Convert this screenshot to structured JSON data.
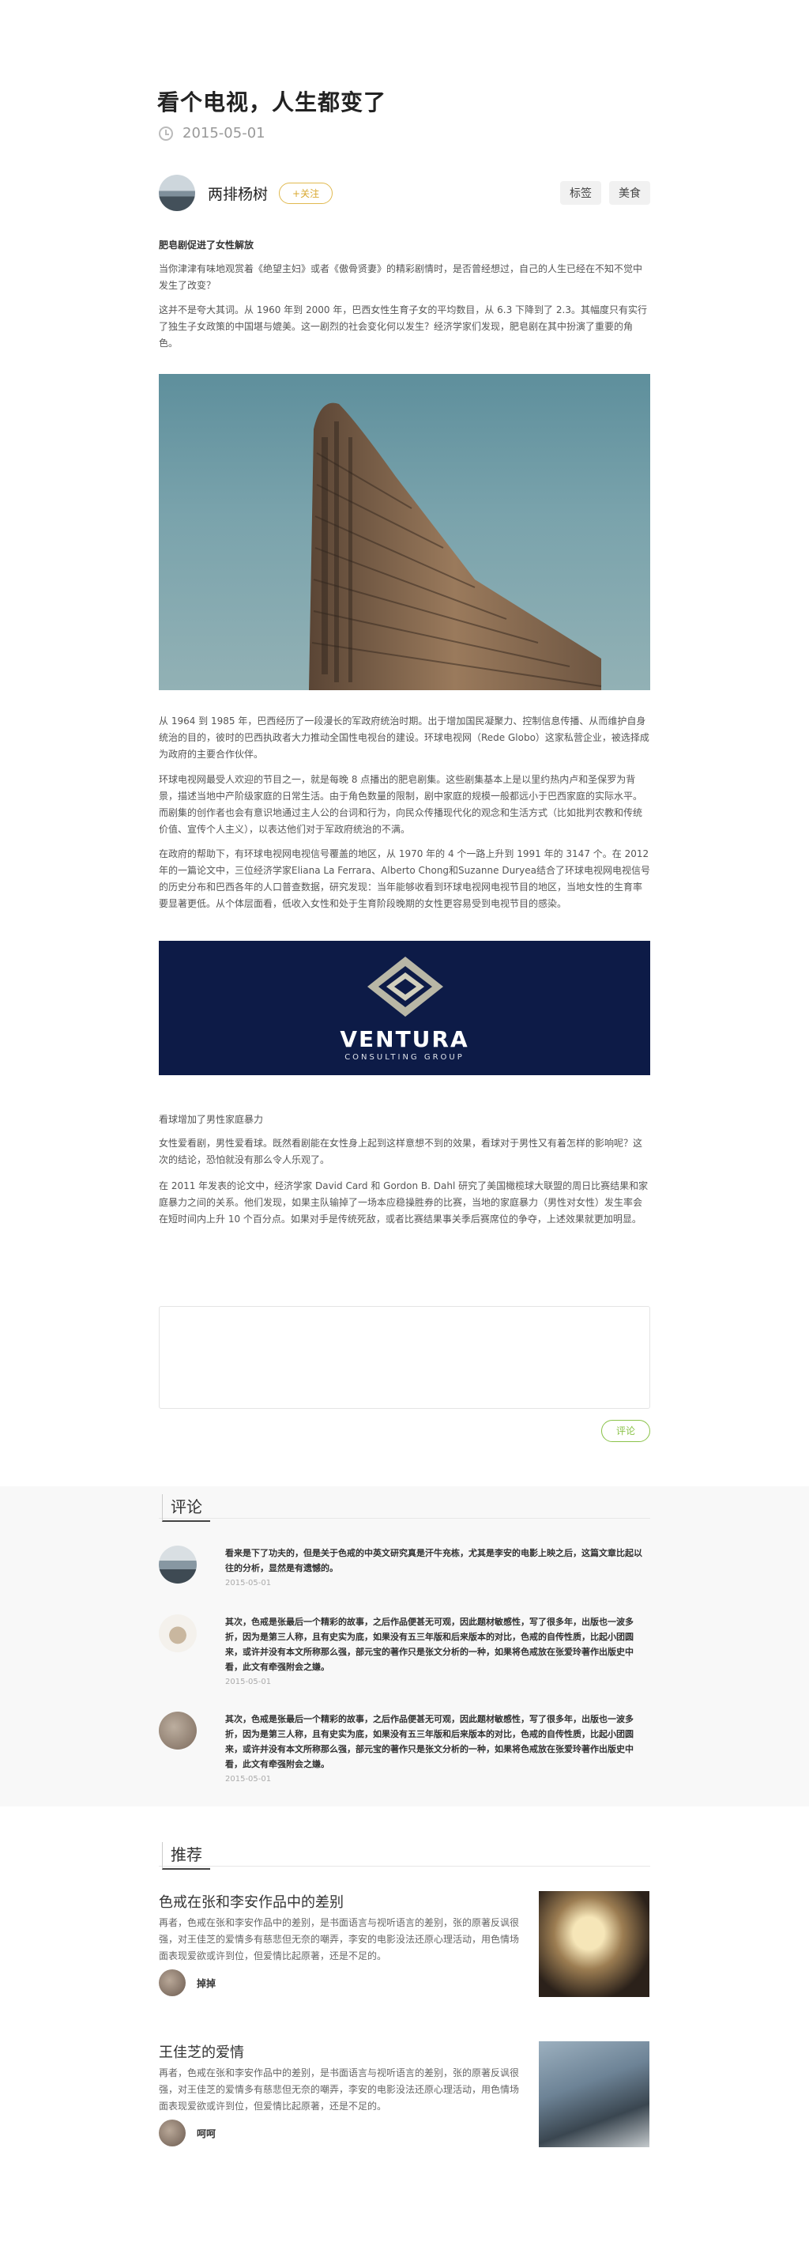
{
  "article": {
    "title": "看个电视，人生都变了",
    "date": "2015-05-01",
    "author": "两排杨树",
    "follow_label": "+关注",
    "tags": [
      "标签",
      "美食"
    ]
  },
  "content": {
    "heading1": "肥皂剧促进了女性解放",
    "para1": "当你津津有味地观赏着《绝望主妇》或者《傲骨贤妻》的精彩剧情时，是否曾经想过，自己的人生已经在不知不觉中发生了改变？",
    "para2": "这并不是夸大其词。从 1960 年到 2000 年，巴西女性生育子女的平均数目，从 6.3 下降到了 2.3。其幅度只有实行了独生子女政策的中国堪与媲美。这一剧烈的社会变化何以发生？经济学家们发现，肥皂剧在其中扮演了重要的角色。",
    "para3": "从 1964 到 1985 年，巴西经历了一段漫长的军政府统治时期。出于增加国民凝聚力、控制信息传播、从而维护自身统治的目的，彼时的巴西执政者大力推动全国性电视台的建设。环球电视网（Rede Globo）这家私营企业，被选择成为政府的主要合作伙伴。",
    "para4": "环球电视网最受人欢迎的节目之一，就是每晚 8 点播出的肥皂剧集。这些剧集基本上是以里约热内卢和圣保罗为背景，描述当地中产阶级家庭的日常生活。由于角色数量的限制，剧中家庭的规模一般都远小于巴西家庭的实际水平。而剧集的创作者也会有意识地通过主人公的台词和行为，向民众传播现代化的观念和生活方式（比如批判农教和传统价值、宣传个人主义），以表达他们对于军政府统治的不满。",
    "para5": "在政府的帮助下，有环球电视网电视信号覆盖的地区，从 1970 年的 4 个一路上升到 1991 年的 3147 个。在 2012 年的一篇论文中，三位经济学家Eliana La Ferrara、Alberto Chong和Suzanne Duryea结合了环球电视网电视信号的历史分布和巴西各年的人口普查数据，研究发现：当年能够收看到环球电视网电视节目的地区，当地女性的生育率要显著更低。从个体层面看，低收入女性和处于生育阶段晚期的女性更容易受到电视节目的感染。",
    "heading2": "看球增加了男性家庭暴力",
    "para6": "女性爱看剧，男性爱看球。既然看剧能在女性身上起到这样意想不到的效果，看球对于男性又有着怎样的影响呢？这次的结论，恐怕就没有那么令人乐观了。",
    "para7": "在 2011 年发表的论文中，经济学家 David Card 和 Gordon B. Dahl 研究了美国橄榄球大联盟的周日比赛结果和家庭暴力之间的关系。他们发现，如果主队输掉了一场本应稳操胜券的比赛，当地的家庭暴力（男性对女性）发生率会在短时间内上升 10 个百分点。如果对手是传统死敌，或者比赛结果事关季后赛席位的争夺，上述效果就更加明显。"
  },
  "ad": {
    "brand": "VENTURA",
    "tagline": "CONSULTING GROUP"
  },
  "comment_form": {
    "submit_label": "评论"
  },
  "comments": {
    "heading": "评论",
    "items": [
      {
        "text": "看来是下了功夫的，但是关于色戒的中英文研究真是汗牛充栋，尤其是李安的电影上映之后，这篇文章比起以往的分析，显然是有遗憾的。",
        "date": "2015-05-01"
      },
      {
        "text": "其次，色戒是张最后一个精彩的故事，之后作品便甚无可观，因此题材敏感性，写了很多年，出版也一波多折，因为是第三人称，且有史实为底，如果没有五三年版和后来版本的对比，色戒的自传性质，比起小团圆来，或许并没有本文所称那么强，部元宝的著作只是张文分析的一种，如果将色戒放在张爱玲著作出版史中看，此文有牵强附会之嫌。",
        "date": "2015-05-01"
      },
      {
        "text": "其次，色戒是张最后一个精彩的故事，之后作品便甚无可观，因此题材敏感性，写了很多年，出版也一波多折，因为是第三人称，且有史实为底，如果没有五三年版和后来版本的对比，色戒的自传性质，比起小团圆来，或许并没有本文所称那么强，部元宝的著作只是张文分析的一种，如果将色戒放在张爱玲著作出版史中看，此文有牵强附会之嫌。",
        "date": "2015-05-01"
      }
    ]
  },
  "recommend": {
    "heading": "推荐",
    "items": [
      {
        "title": "色戒在张和李安作品中的差别",
        "text": "再者，色戒在张和李安作品中的差别，是书面语言与视听语言的差别，张的原著反讽很强，对王佳芝的爱情多有慈悲但无奈的嘲弄，李安的电影没法还原心理活动，用色情场面表现爱欲或许到位，但爱情比起原著，还是不足的。",
        "author": "掉掉"
      },
      {
        "title": "王佳芝的爱情",
        "text": "再者，色戒在张和李安作品中的差别，是书面语言与视听语言的差别，张的原著反讽很强，对王佳芝的爱情多有慈悲但无奈的嘲弄，李安的电影没法还原心理活动，用色情场面表现爱欲或许到位，但爱情比起原著，还是不足的。",
        "author": "呵呵"
      }
    ]
  },
  "colors": {
    "accent_gold": "#d9a932",
    "accent_green": "#8bc34a",
    "ad_background": "#0d1b47"
  }
}
